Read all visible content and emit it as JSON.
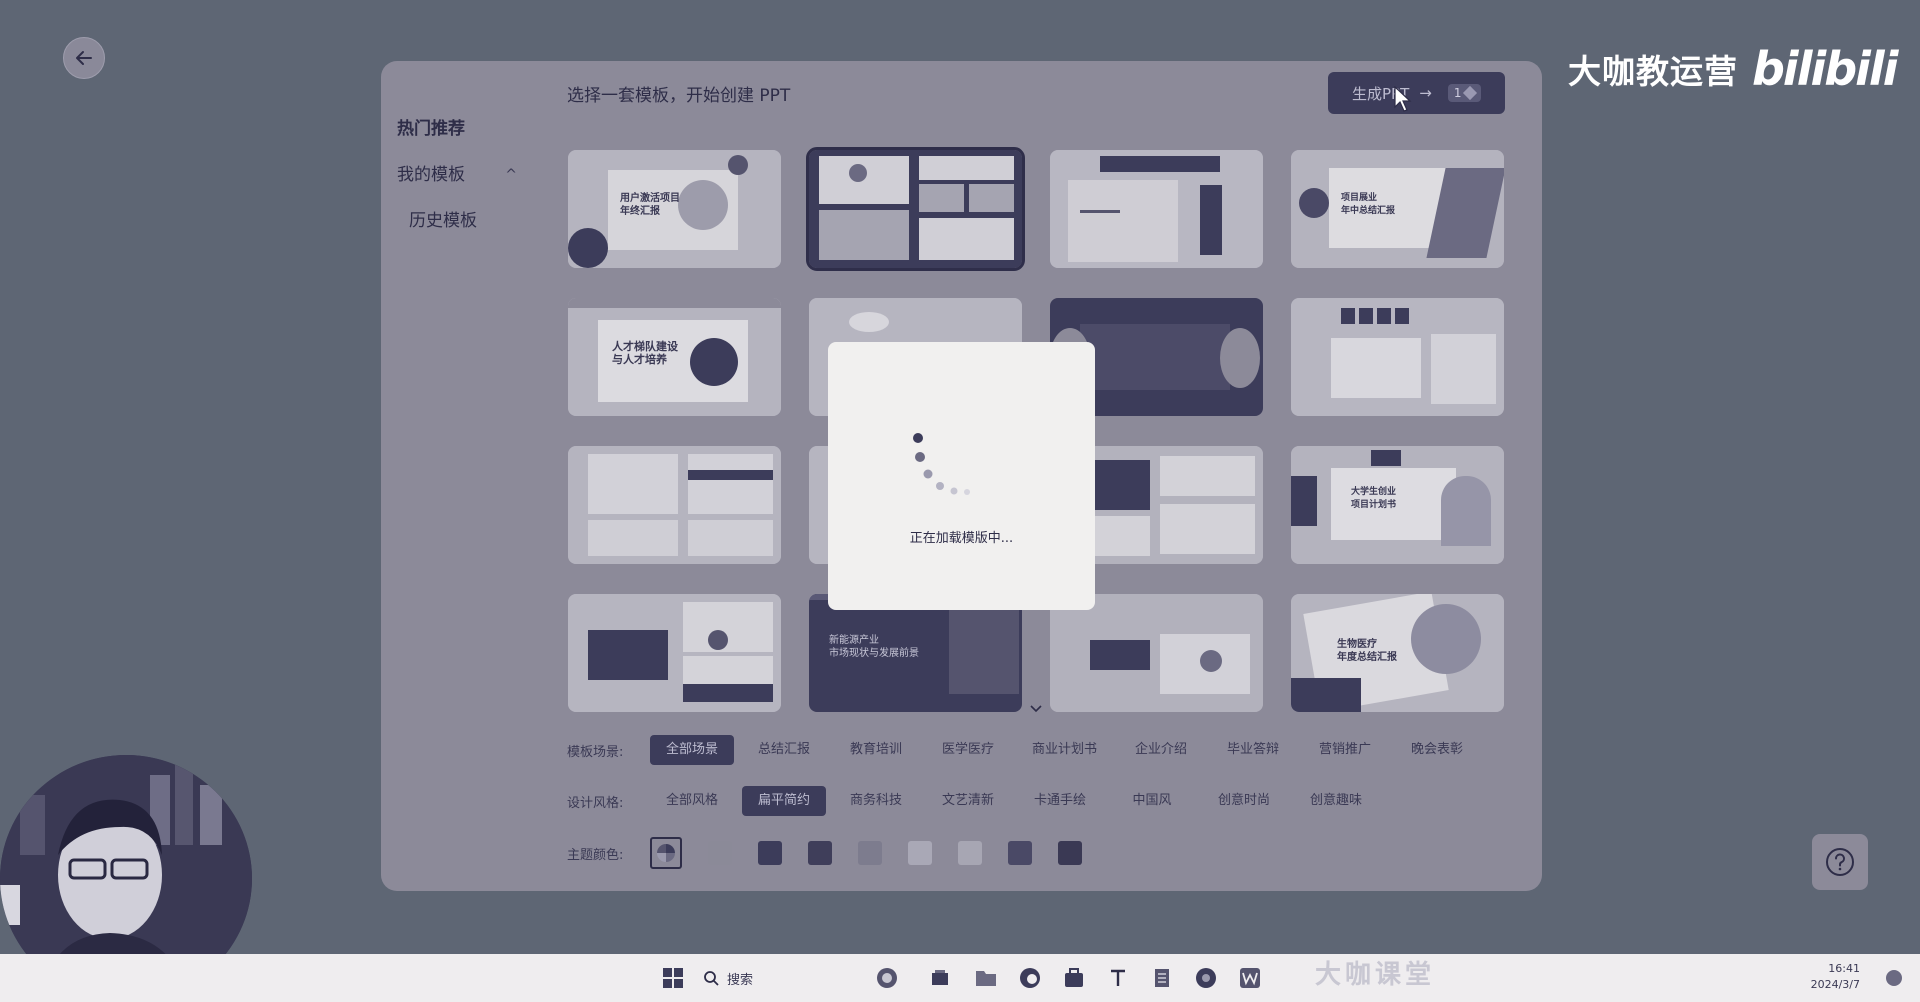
{
  "watermark": {
    "text": "大咖教运营",
    "logo": "bilibili"
  },
  "panel": {
    "title": "选择一套模板，开始创建 PPT"
  },
  "generate_button": {
    "label": "生成PPT",
    "arrow": "→",
    "count": "1"
  },
  "sidebar": {
    "items": [
      {
        "label": "热门推荐"
      },
      {
        "label": "我的模板",
        "caret": "^"
      },
      {
        "label": "历史模板"
      }
    ]
  },
  "thumbnails": {
    "captions": [
      "用户激活项目\n年终汇报",
      "",
      "",
      "项目展业\n年中总结汇报",
      "人才梯队建设\n与人才培养",
      "",
      "",
      "",
      "",
      "",
      "",
      "大学生创业\n项目计划书",
      "",
      "新能源产业\n市场现状与发展前景",
      "",
      "生物医疗\n年度总结汇报"
    ]
  },
  "filters": {
    "scene": {
      "label": "模板场景:",
      "options": [
        "全部场景",
        "总结汇报",
        "教育培训",
        "医学医疗",
        "商业计划书",
        "企业介绍",
        "毕业答辩",
        "营销推广",
        "晚会表彰"
      ],
      "selected": "全部场景"
    },
    "style": {
      "label": "设计风格:",
      "options": [
        "全部风格",
        "扁平简约",
        "商务科技",
        "文艺清新",
        "卡通手绘",
        "中国风",
        "创意时尚",
        "创意趣味"
      ],
      "selected": "扁平简约"
    },
    "color": {
      "label": "主题颜色:",
      "swatches": [
        "#8c8a99",
        "#8b8a98",
        "#3c3c5a",
        "#3f3e5a",
        "#7d7c8e",
        "#a9a8b6",
        "#a7a6b3",
        "#4a4966",
        "#3a3954"
      ]
    }
  },
  "modal": {
    "text": "正在加载模版中..."
  },
  "taskbar": {
    "search_label": "搜索",
    "watermark": "大咖课堂",
    "time": "16:41",
    "date": "2024/3/7"
  }
}
